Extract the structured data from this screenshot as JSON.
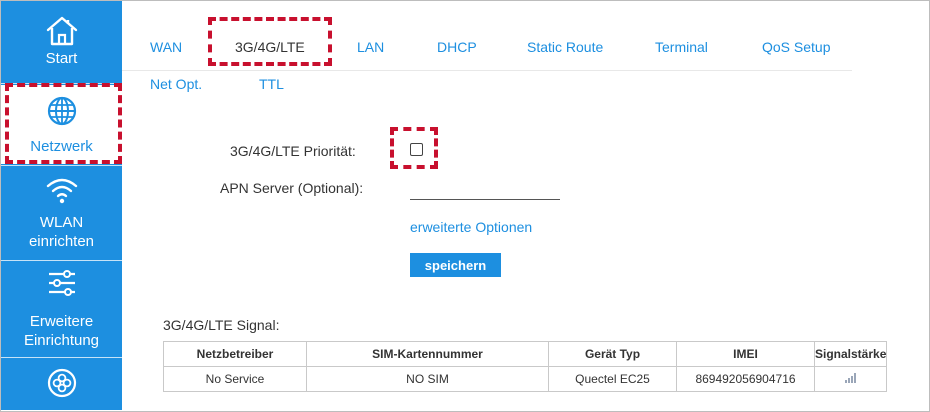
{
  "sidebar": {
    "items": [
      {
        "label": "Start",
        "icon": "home-icon"
      },
      {
        "label": "Netzwerk",
        "icon": "globe-icon"
      },
      {
        "label": "WLAN einrichten",
        "label_line1": "WLAN",
        "label_line2": "einrichten",
        "icon": "wifi-icon"
      },
      {
        "label": "Erweitere Einrichtung",
        "label_line1": "Erweitere",
        "label_line2": "Einrichtung",
        "icon": "sliders-icon"
      },
      {
        "label": "",
        "icon": "flower-icon"
      }
    ]
  },
  "tabs": [
    "WAN",
    "3G/4G/LTE",
    "LAN",
    "DHCP",
    "Static Route",
    "Terminal",
    "QoS Setup",
    "Net Opt.",
    "TTL"
  ],
  "active_tab": "3G/4G/LTE",
  "form": {
    "priority_label": "3G/4G/LTE Priorität:",
    "priority_checked": false,
    "apn_label": "APN Server (Optional):",
    "apn_value": "",
    "advanced_link": "erweiterte Optionen",
    "save_button": "speichern"
  },
  "signal": {
    "title": "3G/4G/LTE Signal:",
    "headers": [
      "Netzbetreiber",
      "SIM-Kartennummer",
      "Gerät Typ",
      "IMEI",
      "Signalstärke"
    ],
    "row": [
      "No Service",
      "NO SIM",
      "Quectel EC25",
      "869492056904716"
    ],
    "strength_level": 0
  },
  "colors": {
    "accent": "#1d8fe0",
    "highlight": "#c8102e",
    "text": "#333333"
  }
}
